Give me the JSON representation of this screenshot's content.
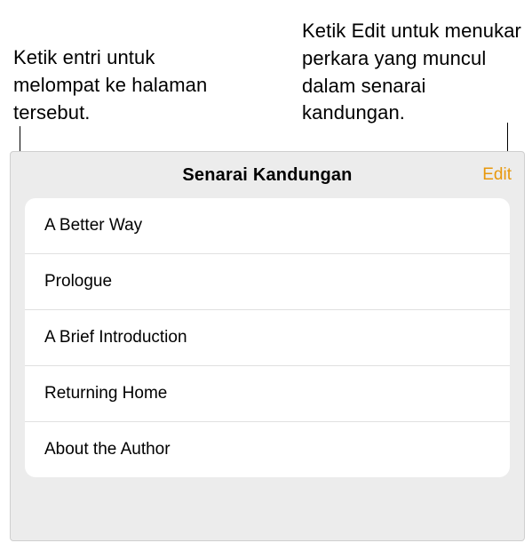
{
  "callouts": {
    "left": "Ketik entri untuk melompat ke halaman tersebut.",
    "right": "Ketik Edit untuk menukar perkara yang muncul dalam senarai kandungan."
  },
  "panel": {
    "title": "Senarai Kandungan",
    "edit_label": "Edit"
  },
  "toc": {
    "items": [
      {
        "label": "A Better Way"
      },
      {
        "label": "Prologue"
      },
      {
        "label": "A Brief Introduction"
      },
      {
        "label": "Returning Home"
      },
      {
        "label": "About the Author"
      }
    ]
  }
}
